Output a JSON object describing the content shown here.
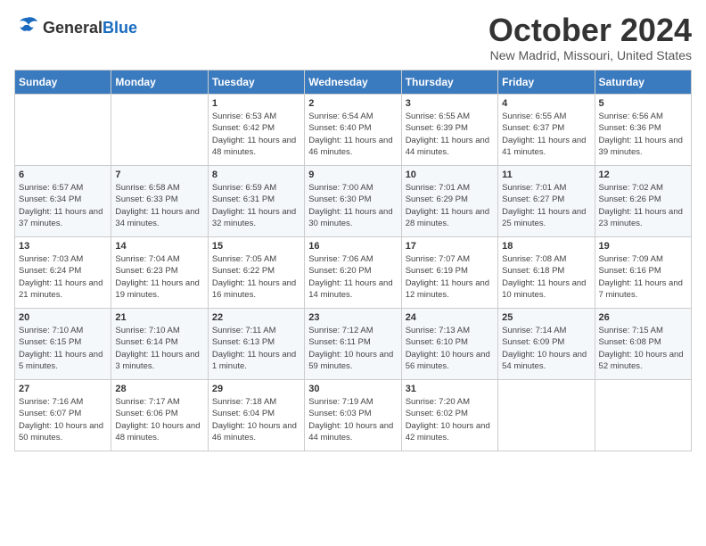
{
  "logo": {
    "general": "General",
    "blue": "Blue"
  },
  "title": "October 2024",
  "location": "New Madrid, Missouri, United States",
  "days_of_week": [
    "Sunday",
    "Monday",
    "Tuesday",
    "Wednesday",
    "Thursday",
    "Friday",
    "Saturday"
  ],
  "weeks": [
    [
      {
        "day": "",
        "info": ""
      },
      {
        "day": "",
        "info": ""
      },
      {
        "day": "1",
        "info": "Sunrise: 6:53 AM\nSunset: 6:42 PM\nDaylight: 11 hours and 48 minutes."
      },
      {
        "day": "2",
        "info": "Sunrise: 6:54 AM\nSunset: 6:40 PM\nDaylight: 11 hours and 46 minutes."
      },
      {
        "day": "3",
        "info": "Sunrise: 6:55 AM\nSunset: 6:39 PM\nDaylight: 11 hours and 44 minutes."
      },
      {
        "day": "4",
        "info": "Sunrise: 6:55 AM\nSunset: 6:37 PM\nDaylight: 11 hours and 41 minutes."
      },
      {
        "day": "5",
        "info": "Sunrise: 6:56 AM\nSunset: 6:36 PM\nDaylight: 11 hours and 39 minutes."
      }
    ],
    [
      {
        "day": "6",
        "info": "Sunrise: 6:57 AM\nSunset: 6:34 PM\nDaylight: 11 hours and 37 minutes."
      },
      {
        "day": "7",
        "info": "Sunrise: 6:58 AM\nSunset: 6:33 PM\nDaylight: 11 hours and 34 minutes."
      },
      {
        "day": "8",
        "info": "Sunrise: 6:59 AM\nSunset: 6:31 PM\nDaylight: 11 hours and 32 minutes."
      },
      {
        "day": "9",
        "info": "Sunrise: 7:00 AM\nSunset: 6:30 PM\nDaylight: 11 hours and 30 minutes."
      },
      {
        "day": "10",
        "info": "Sunrise: 7:01 AM\nSunset: 6:29 PM\nDaylight: 11 hours and 28 minutes."
      },
      {
        "day": "11",
        "info": "Sunrise: 7:01 AM\nSunset: 6:27 PM\nDaylight: 11 hours and 25 minutes."
      },
      {
        "day": "12",
        "info": "Sunrise: 7:02 AM\nSunset: 6:26 PM\nDaylight: 11 hours and 23 minutes."
      }
    ],
    [
      {
        "day": "13",
        "info": "Sunrise: 7:03 AM\nSunset: 6:24 PM\nDaylight: 11 hours and 21 minutes."
      },
      {
        "day": "14",
        "info": "Sunrise: 7:04 AM\nSunset: 6:23 PM\nDaylight: 11 hours and 19 minutes."
      },
      {
        "day": "15",
        "info": "Sunrise: 7:05 AM\nSunset: 6:22 PM\nDaylight: 11 hours and 16 minutes."
      },
      {
        "day": "16",
        "info": "Sunrise: 7:06 AM\nSunset: 6:20 PM\nDaylight: 11 hours and 14 minutes."
      },
      {
        "day": "17",
        "info": "Sunrise: 7:07 AM\nSunset: 6:19 PM\nDaylight: 11 hours and 12 minutes."
      },
      {
        "day": "18",
        "info": "Sunrise: 7:08 AM\nSunset: 6:18 PM\nDaylight: 11 hours and 10 minutes."
      },
      {
        "day": "19",
        "info": "Sunrise: 7:09 AM\nSunset: 6:16 PM\nDaylight: 11 hours and 7 minutes."
      }
    ],
    [
      {
        "day": "20",
        "info": "Sunrise: 7:10 AM\nSunset: 6:15 PM\nDaylight: 11 hours and 5 minutes."
      },
      {
        "day": "21",
        "info": "Sunrise: 7:10 AM\nSunset: 6:14 PM\nDaylight: 11 hours and 3 minutes."
      },
      {
        "day": "22",
        "info": "Sunrise: 7:11 AM\nSunset: 6:13 PM\nDaylight: 11 hours and 1 minute."
      },
      {
        "day": "23",
        "info": "Sunrise: 7:12 AM\nSunset: 6:11 PM\nDaylight: 10 hours and 59 minutes."
      },
      {
        "day": "24",
        "info": "Sunrise: 7:13 AM\nSunset: 6:10 PM\nDaylight: 10 hours and 56 minutes."
      },
      {
        "day": "25",
        "info": "Sunrise: 7:14 AM\nSunset: 6:09 PM\nDaylight: 10 hours and 54 minutes."
      },
      {
        "day": "26",
        "info": "Sunrise: 7:15 AM\nSunset: 6:08 PM\nDaylight: 10 hours and 52 minutes."
      }
    ],
    [
      {
        "day": "27",
        "info": "Sunrise: 7:16 AM\nSunset: 6:07 PM\nDaylight: 10 hours and 50 minutes."
      },
      {
        "day": "28",
        "info": "Sunrise: 7:17 AM\nSunset: 6:06 PM\nDaylight: 10 hours and 48 minutes."
      },
      {
        "day": "29",
        "info": "Sunrise: 7:18 AM\nSunset: 6:04 PM\nDaylight: 10 hours and 46 minutes."
      },
      {
        "day": "30",
        "info": "Sunrise: 7:19 AM\nSunset: 6:03 PM\nDaylight: 10 hours and 44 minutes."
      },
      {
        "day": "31",
        "info": "Sunrise: 7:20 AM\nSunset: 6:02 PM\nDaylight: 10 hours and 42 minutes."
      },
      {
        "day": "",
        "info": ""
      },
      {
        "day": "",
        "info": ""
      }
    ]
  ]
}
